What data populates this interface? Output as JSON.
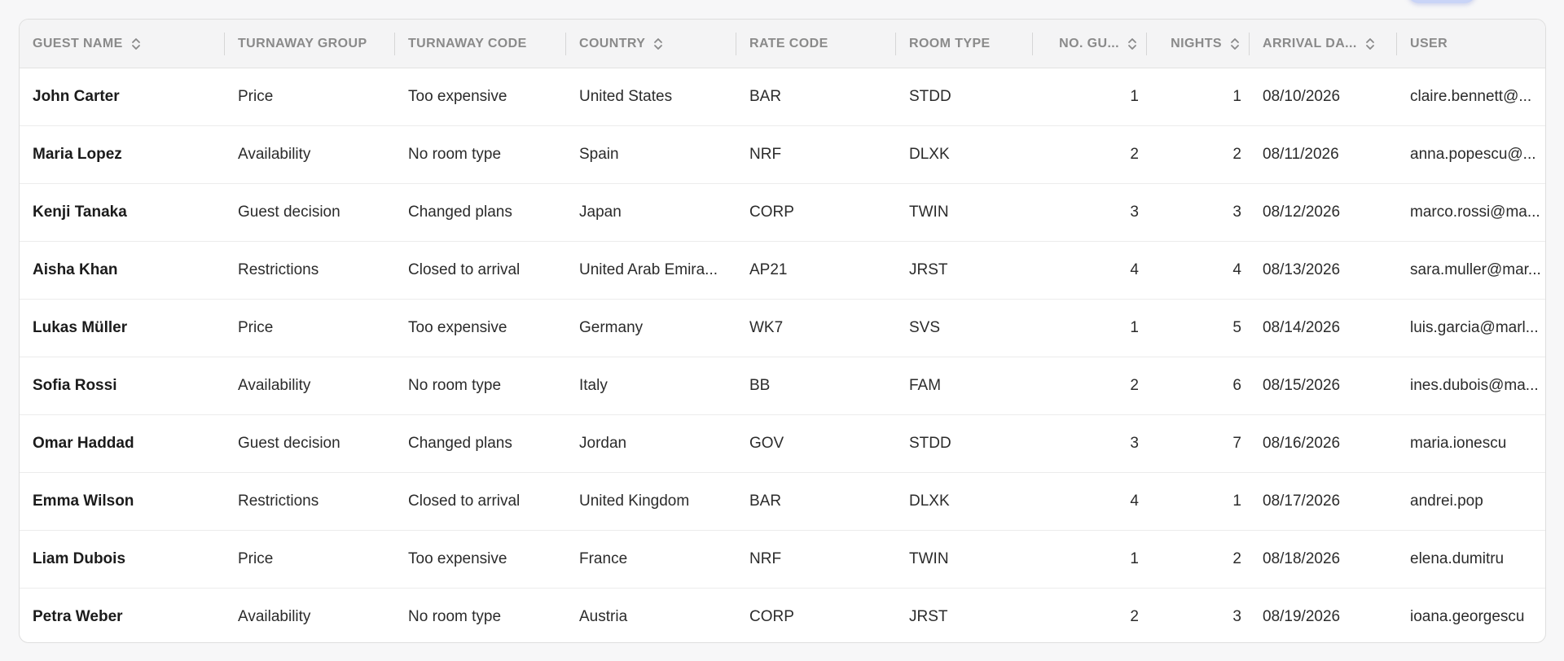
{
  "table": {
    "columns": [
      {
        "key": "guest_name",
        "label": "GUEST NAME",
        "sortable": true,
        "align": "left"
      },
      {
        "key": "turnaway_group",
        "label": "TURNAWAY GROUP",
        "sortable": false,
        "align": "left"
      },
      {
        "key": "turnaway_code",
        "label": "TURNAWAY CODE",
        "sortable": false,
        "align": "left"
      },
      {
        "key": "country",
        "label": "COUNTRY",
        "sortable": true,
        "align": "left"
      },
      {
        "key": "rate_code",
        "label": "RATE CODE",
        "sortable": false,
        "align": "left"
      },
      {
        "key": "room_type",
        "label": "ROOM TYPE",
        "sortable": false,
        "align": "left"
      },
      {
        "key": "no_guests",
        "label": "NO. GU...",
        "sortable": true,
        "align": "right"
      },
      {
        "key": "nights",
        "label": "NIGHTS",
        "sortable": true,
        "align": "right"
      },
      {
        "key": "arrival_date",
        "label": "ARRIVAL DA...",
        "sortable": true,
        "align": "left"
      },
      {
        "key": "user",
        "label": "USER",
        "sortable": false,
        "align": "left"
      }
    ],
    "rows": [
      {
        "guest_name": "John Carter",
        "turnaway_group": "Price",
        "turnaway_code": "Too expensive",
        "country": "United States",
        "rate_code": "BAR",
        "room_type": "STDD",
        "no_guests": "1",
        "nights": "1",
        "arrival_date": "08/10/2026",
        "user": "claire.bennett@..."
      },
      {
        "guest_name": "Maria Lopez",
        "turnaway_group": "Availability",
        "turnaway_code": "No room type",
        "country": "Spain",
        "rate_code": "NRF",
        "room_type": "DLXK",
        "no_guests": "2",
        "nights": "2",
        "arrival_date": "08/11/2026",
        "user": "anna.popescu@..."
      },
      {
        "guest_name": "Kenji Tanaka",
        "turnaway_group": "Guest decision",
        "turnaway_code": "Changed plans",
        "country": "Japan",
        "rate_code": "CORP",
        "room_type": "TWIN",
        "no_guests": "3",
        "nights": "3",
        "arrival_date": "08/12/2026",
        "user": "marco.rossi@ma..."
      },
      {
        "guest_name": "Aisha Khan",
        "turnaway_group": "Restrictions",
        "turnaway_code": "Closed to arrival",
        "country": "United Arab Emira...",
        "rate_code": "AP21",
        "room_type": "JRST",
        "no_guests": "4",
        "nights": "4",
        "arrival_date": "08/13/2026",
        "user": "sara.muller@mar..."
      },
      {
        "guest_name": "Lukas Müller",
        "turnaway_group": "Price",
        "turnaway_code": "Too expensive",
        "country": "Germany",
        "rate_code": "WK7",
        "room_type": "SVS",
        "no_guests": "1",
        "nights": "5",
        "arrival_date": "08/14/2026",
        "user": "luis.garcia@marl..."
      },
      {
        "guest_name": "Sofia Rossi",
        "turnaway_group": "Availability",
        "turnaway_code": "No room type",
        "country": "Italy",
        "rate_code": "BB",
        "room_type": "FAM",
        "no_guests": "2",
        "nights": "6",
        "arrival_date": "08/15/2026",
        "user": "ines.dubois@ma..."
      },
      {
        "guest_name": "Omar Haddad",
        "turnaway_group": "Guest decision",
        "turnaway_code": "Changed plans",
        "country": "Jordan",
        "rate_code": "GOV",
        "room_type": "STDD",
        "no_guests": "3",
        "nights": "7",
        "arrival_date": "08/16/2026",
        "user": "maria.ionescu"
      },
      {
        "guest_name": "Emma Wilson",
        "turnaway_group": "Restrictions",
        "turnaway_code": "Closed to arrival",
        "country": "United Kingdom",
        "rate_code": "BAR",
        "room_type": "DLXK",
        "no_guests": "4",
        "nights": "1",
        "arrival_date": "08/17/2026",
        "user": "andrei.pop"
      },
      {
        "guest_name": "Liam Dubois",
        "turnaway_group": "Price",
        "turnaway_code": "Too expensive",
        "country": "France",
        "rate_code": "NRF",
        "room_type": "TWIN",
        "no_guests": "1",
        "nights": "2",
        "arrival_date": "08/18/2026",
        "user": "elena.dumitru"
      },
      {
        "guest_name": "Petra Weber",
        "turnaway_group": "Availability",
        "turnaway_code": "No room type",
        "country": "Austria",
        "rate_code": "CORP",
        "room_type": "JRST",
        "no_guests": "2",
        "nights": "3",
        "arrival_date": "08/19/2026",
        "user": "ioana.georgescu"
      }
    ]
  },
  "icons": {
    "sort": "sort-up-down-icon"
  },
  "colors": {
    "header_bg": "#f4f4f5",
    "header_text": "#8a8a8a",
    "accent_pill": "#c9d4f7"
  }
}
